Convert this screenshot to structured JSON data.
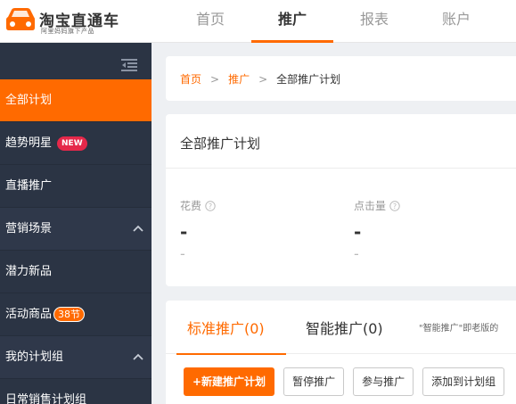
{
  "logo": {
    "title": "淘宝直通车",
    "subtitle": "阿里妈妈旗下产品"
  },
  "top_nav": [
    {
      "label": "首页",
      "active": false
    },
    {
      "label": "推广",
      "active": true
    },
    {
      "label": "报表",
      "active": false
    },
    {
      "label": "账户",
      "active": false
    }
  ],
  "sidebar": {
    "items": [
      {
        "label": "全部计划",
        "active": true
      },
      {
        "label": "趋势明星",
        "badge": "NEW"
      },
      {
        "label": "直播推广"
      },
      {
        "label": "营销场景",
        "expanded": true
      },
      {
        "label": "潜力新品"
      },
      {
        "label": "活动商品",
        "badge": "38节"
      },
      {
        "label": "我的计划组",
        "expanded": true
      },
      {
        "label": "日常销售计划组"
      }
    ]
  },
  "breadcrumb": {
    "home": "首页",
    "promo": "推广",
    "current": "全部推广计划",
    "separator": ">"
  },
  "summary": {
    "title": "全部推广计划",
    "metrics": [
      {
        "label": "花费",
        "value": "-",
        "compare": "-"
      },
      {
        "label": "点击量",
        "value": "-",
        "compare": "-"
      }
    ]
  },
  "tabs": {
    "items": [
      {
        "label": "标准推广(0)",
        "active": true
      },
      {
        "label": "智能推广(0)",
        "active": false
      }
    ],
    "note": "\"智能推广\"即老版的"
  },
  "actions": {
    "new_plan": "+新建推广计划",
    "pause": "暂停推广",
    "join": "参与推广",
    "add_to_group": "添加到计划组"
  },
  "colors": {
    "accent": "#ff6a00",
    "sidebar_bg": "#2b3444",
    "badge_new": "#e5284a"
  },
  "icons": {
    "collapse": "collapse-menu-icon",
    "chevron": "chevron-up-icon",
    "help": "question-circle-icon"
  }
}
